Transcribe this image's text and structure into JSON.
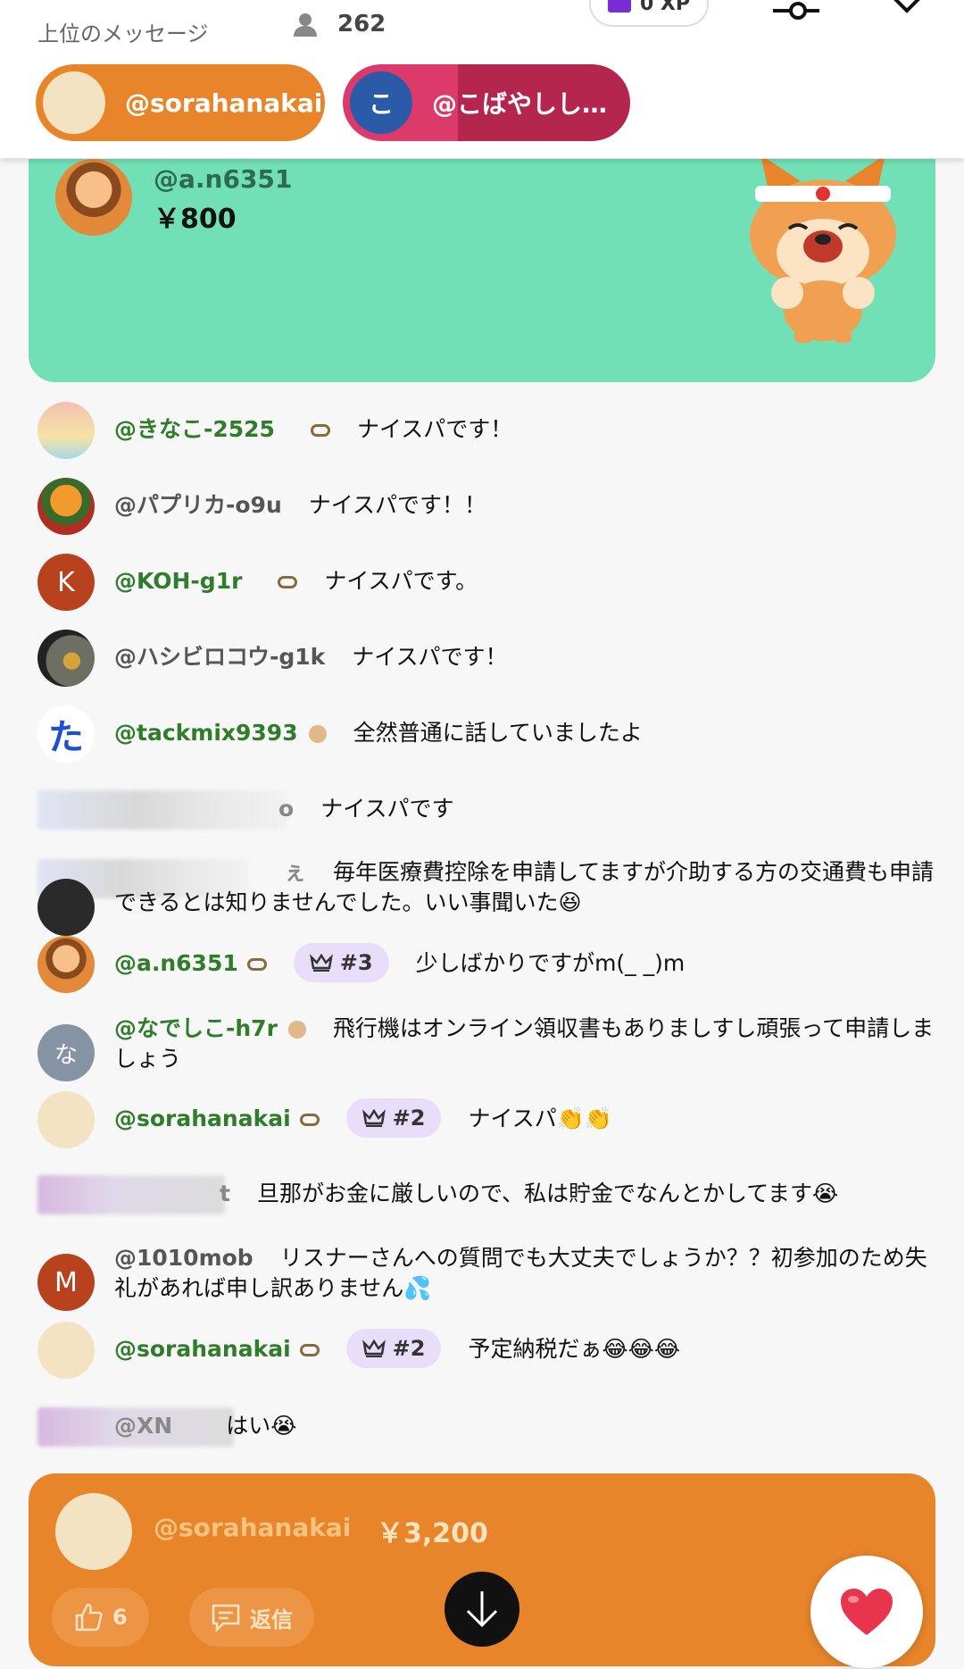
{
  "header": {
    "top_label": "上位のメッセージ",
    "viewer_count": "262",
    "xp": "0 XP",
    "chips": [
      {
        "avatar_letter": "",
        "name": "@sorahanakai"
      },
      {
        "avatar_letter": "こ",
        "name": "@こばやしし…"
      }
    ]
  },
  "pinned": {
    "username": "@a.n6351",
    "amount": "￥800"
  },
  "messages": [
    {
      "user": "@きなこ-2525",
      "text": "ナイスパです！"
    },
    {
      "user": "@パプリカ-o9u",
      "text": "ナイスパです！！"
    },
    {
      "avatar_letter": "K",
      "user": "@KOH-g1r",
      "text": "ナイスパです。"
    },
    {
      "user": "@ハシビロコウ-g1k",
      "text": "ナイスパです！"
    },
    {
      "user": "@tackmix9393",
      "text": "全然普通に話していましたよ"
    },
    {
      "user_fragment": "o",
      "text": "ナイスパです"
    },
    {
      "user_fragment": "ぇ",
      "text": "毎年医療費控除を申請してますが介助する方の交通費も申請できるとは知りませんでした。いい事聞いた😆"
    },
    {
      "user": "@a.n6351",
      "rank": "#3",
      "text": "少しばかりですがm(_ _)m"
    },
    {
      "avatar_letter": "な",
      "user": "@なでしこ-h7r",
      "text": "飛行機はオンライン領収書もありましすし頑張って申請しましょう"
    },
    {
      "user": "@sorahanakai",
      "rank": "#2",
      "text": "ナイスパ👏👏"
    },
    {
      "user_fragment": "t",
      "text": "旦那がお金に厳しいので、私は貯金でなんとかしてます😭"
    },
    {
      "avatar_letter": "M",
      "user": "@1010mob",
      "text": "リスナーさんへの質問でも大丈夫でしょうか？？初参加のため失礼があれば申し訳ありません💦"
    },
    {
      "user": "@sorahanakai",
      "rank": "#2",
      "text": "予定納税だぁ😂😂😂"
    },
    {
      "user_fragment": "@XN",
      "text": "はい😭"
    }
  ],
  "bottom_card": {
    "username": "@sorahanakai",
    "amount": "￥3,200",
    "like_count": "6",
    "reply_label": "返信"
  },
  "colors": {
    "green_card": "#72e0b6",
    "orange": "#e8852b",
    "pink": "#dc3a6b",
    "rank_bg": "#e8defa"
  }
}
